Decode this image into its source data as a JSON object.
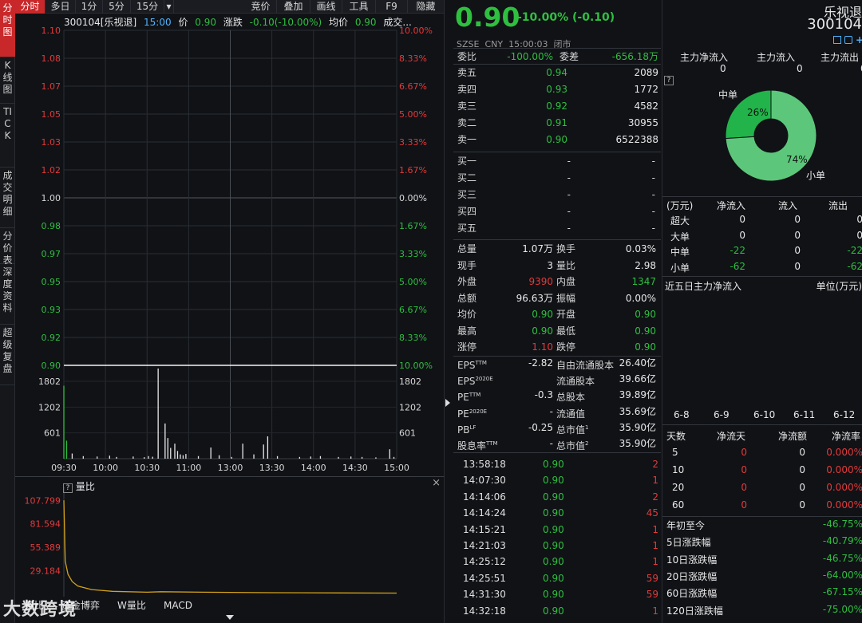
{
  "left_tabs": [
    "分时图",
    "K线图",
    "TICK",
    "成交明细",
    "分价表",
    "深度资料",
    "超级复盘"
  ],
  "toolbar": {
    "tabs": [
      "分时",
      "多日",
      "1分",
      "5分",
      "15分",
      "▾"
    ],
    "tools": [
      "竞价",
      "叠加",
      "画线",
      "工具",
      "F9",
      "隐藏"
    ]
  },
  "info": {
    "code_name": "300104[乐视退]",
    "time": "15:00",
    "price_label": "价",
    "price": "0.90",
    "change_label": "涨跌",
    "change": "-0.10(-10.00%)",
    "avg_label": "均价",
    "avg": "0.90",
    "vol_label": "成交..."
  },
  "chart_data": {
    "type": "line",
    "price_ticks": [
      "1.10",
      "1.08",
      "1.07",
      "1.05",
      "1.03",
      "1.02",
      "1.00",
      "0.98",
      "0.97",
      "0.95",
      "0.93",
      "0.92",
      "0.90"
    ],
    "pct_ticks": [
      "10.00%",
      "8.33%",
      "6.67%",
      "5.00%",
      "3.33%",
      "1.67%",
      "0.00%",
      "1.67%",
      "3.33%",
      "5.00%",
      "6.67%",
      "8.33%",
      "10.00%"
    ],
    "volume_ticks": [
      "1802",
      "1202",
      "601"
    ],
    "time_ticks": [
      "09:30",
      "10:00",
      "10:30",
      "11:00",
      "13:00",
      "13:30",
      "14:00",
      "14:30",
      "15:00"
    ],
    "price_line": {
      "value": 0.9,
      "from": "09:30",
      "to": "15:00"
    },
    "ylim": [
      0.9,
      1.1
    ],
    "volume_ylim": [
      0,
      2100
    ],
    "volume_bars": [
      {
        "t": 0,
        "v": 1700
      },
      {
        "t": 2,
        "v": 420
      },
      {
        "t": 6,
        "v": 120
      },
      {
        "t": 14,
        "v": 60
      },
      {
        "t": 24,
        "v": 50
      },
      {
        "t": 33,
        "v": 70
      },
      {
        "t": 38,
        "v": 40
      },
      {
        "t": 50,
        "v": 50
      },
      {
        "t": 58,
        "v": 35
      },
      {
        "t": 61,
        "v": 60
      },
      {
        "t": 64,
        "v": 45
      },
      {
        "t": 68,
        "v": 2100
      },
      {
        "t": 73,
        "v": 820
      },
      {
        "t": 75,
        "v": 480
      },
      {
        "t": 77,
        "v": 250
      },
      {
        "t": 80,
        "v": 350
      },
      {
        "t": 82,
        "v": 180
      },
      {
        "t": 84,
        "v": 100
      },
      {
        "t": 86,
        "v": 80
      },
      {
        "t": 88,
        "v": 110
      },
      {
        "t": 97,
        "v": 60
      },
      {
        "t": 106,
        "v": 260
      },
      {
        "t": 112,
        "v": 80
      },
      {
        "t": 121,
        "v": 40
      },
      {
        "t": 129,
        "v": 350
      },
      {
        "t": 137,
        "v": 100
      },
      {
        "t": 144,
        "v": 330
      },
      {
        "t": 147,
        "v": 520
      },
      {
        "t": 154,
        "v": 60
      },
      {
        "t": 170,
        "v": 40
      },
      {
        "t": 178,
        "v": 50
      },
      {
        "t": 185,
        "v": 60
      },
      {
        "t": 198,
        "v": 40
      },
      {
        "t": 207,
        "v": 50
      },
      {
        "t": 215,
        "v": 40
      },
      {
        "t": 225,
        "v": 30
      },
      {
        "t": 235,
        "v": 220
      },
      {
        "t": 238,
        "v": 40
      }
    ],
    "ratio_ticks": [
      "107.799",
      "81.594",
      "55.389",
      "29.184"
    ],
    "ratio_ylim": [
      0,
      118
    ],
    "ratio_series": [
      {
        "t": 0,
        "v": 108
      },
      {
        "t": 1,
        "v": 40
      },
      {
        "t": 3,
        "v": 25
      },
      {
        "t": 6,
        "v": 17
      },
      {
        "t": 10,
        "v": 12
      },
      {
        "t": 20,
        "v": 8
      },
      {
        "t": 35,
        "v": 6
      },
      {
        "t": 60,
        "v": 5
      },
      {
        "t": 70,
        "v": 5.5
      },
      {
        "t": 100,
        "v": 5
      },
      {
        "t": 150,
        "v": 4.5
      },
      {
        "t": 200,
        "v": 4.2
      },
      {
        "t": 240,
        "v": 4
      }
    ]
  },
  "lower_panel": {
    "title": "量比",
    "tabs": [
      "量比",
      "资金博弈",
      "W量比",
      "MACD"
    ]
  },
  "quote": {
    "price": "0.90",
    "change": "-10.00% (-0.10)",
    "exchange": "SZSE",
    "currency": "CNY",
    "time": "15:00:03",
    "status": "闭市",
    "weibi_label": "委比",
    "weibi": "-100.00%",
    "weicha_label": "委差",
    "weicha": "-656.18万",
    "asks": [
      {
        "label": "卖五",
        "price": "0.94",
        "vol": "2089"
      },
      {
        "label": "卖四",
        "price": "0.93",
        "vol": "1772"
      },
      {
        "label": "卖三",
        "price": "0.92",
        "vol": "4582"
      },
      {
        "label": "卖二",
        "price": "0.91",
        "vol": "30955"
      },
      {
        "label": "卖一",
        "price": "0.90",
        "vol": "6522388"
      }
    ],
    "bids": [
      {
        "label": "买一",
        "price": "-",
        "vol": "-"
      },
      {
        "label": "买二",
        "price": "-",
        "vol": "-"
      },
      {
        "label": "买三",
        "price": "-",
        "vol": "-"
      },
      {
        "label": "买四",
        "price": "-",
        "vol": "-"
      },
      {
        "label": "买五",
        "price": "-",
        "vol": "-"
      }
    ],
    "stats": [
      {
        "l1": "总量",
        "v1": "1.07万",
        "l2": "换手",
        "v2": "0.03%",
        "c1": "white",
        "c2": "white"
      },
      {
        "l1": "现手",
        "v1": "3",
        "l2": "量比",
        "v2": "2.98",
        "c1": "white",
        "c2": "white"
      },
      {
        "l1": "外盘",
        "v1": "9390",
        "l2": "内盘",
        "v2": "1347",
        "c1": "red",
        "c2": "green"
      },
      {
        "l1": "总额",
        "v1": "96.63万",
        "l2": "振幅",
        "v2": "0.00%",
        "c1": "white",
        "c2": "white"
      },
      {
        "l1": "均价",
        "v1": "0.90",
        "l2": "开盘",
        "v2": "0.90",
        "c1": "green",
        "c2": "green"
      },
      {
        "l1": "最高",
        "v1": "0.90",
        "l2": "最低",
        "v2": "0.90",
        "c1": "green",
        "c2": "green"
      },
      {
        "l1": "涨停",
        "v1": "1.10",
        "l2": "跌停",
        "v2": "0.90",
        "c1": "red",
        "c2": "green"
      }
    ],
    "fundamentals": [
      {
        "l1": "EPS",
        "s1": "TTM",
        "v1": "-2.82",
        "l2": "自由流通股本",
        "s2": "",
        "v2": "26.40亿"
      },
      {
        "l1": "EPS",
        "s1": "2020E",
        "v1": "",
        "l2": "流通股本",
        "s2": "",
        "v2": "39.66亿"
      },
      {
        "l1": "PE",
        "s1": "TTM",
        "v1": "-0.3",
        "l2": "总股本",
        "s2": "",
        "v2": "39.89亿"
      },
      {
        "l1": "PE",
        "s1": "2020E",
        "v1": "-",
        "l2": "流通值",
        "s2": "",
        "v2": "35.69亿"
      },
      {
        "l1": "PB",
        "s1": "LF",
        "v1": "-0.25",
        "l2": "总市值",
        "s2": "1",
        "v2": "35.90亿"
      },
      {
        "l1": "股息率",
        "s1": "TTM",
        "v1": "-",
        "l2": "总市值",
        "s2": "2",
        "v2": "35.90亿"
      }
    ],
    "ticks": [
      {
        "t": "13:58:18",
        "p": "0.90",
        "v": "2"
      },
      {
        "t": "14:07:30",
        "p": "0.90",
        "v": "1"
      },
      {
        "t": "14:14:06",
        "p": "0.90",
        "v": "2"
      },
      {
        "t": "14:14:24",
        "p": "0.90",
        "v": "45"
      },
      {
        "t": "14:15:21",
        "p": "0.90",
        "v": "1"
      },
      {
        "t": "14:21:03",
        "p": "0.90",
        "v": "1"
      },
      {
        "t": "14:25:12",
        "p": "0.90",
        "v": "1"
      },
      {
        "t": "14:25:51",
        "p": "0.90",
        "v": "59"
      },
      {
        "t": "14:31:30",
        "p": "0.90",
        "v": "59"
      },
      {
        "t": "14:32:18",
        "p": "0.90",
        "v": "1"
      }
    ]
  },
  "flow": {
    "name": "乐视退",
    "code": "300104",
    "headers": [
      "主力净流入",
      "主力流入",
      "主力流出"
    ],
    "values": [
      "0",
      "0",
      "0"
    ],
    "help": "?",
    "donut": {
      "mid_label": "中单",
      "mid_pct": "26%",
      "small_label": "小单",
      "small_pct": "74%",
      "mid_value": 26,
      "small_value": 74
    },
    "table_headers": [
      "(万元)",
      "净流入",
      "流入",
      "流出"
    ],
    "table_rows": [
      {
        "name": "超大",
        "net": "0",
        "in": "0",
        "out": "0",
        "c": "white"
      },
      {
        "name": "大单",
        "net": "0",
        "in": "0",
        "out": "0",
        "c": "white"
      },
      {
        "name": "中单",
        "net": "-22",
        "in": "0",
        "out": "-22",
        "c": "green"
      },
      {
        "name": "小单",
        "net": "-62",
        "in": "0",
        "out": "-62",
        "c": "green"
      }
    ],
    "five_day_title": "近五日主力净流入",
    "five_day_unit": "单位(万元)",
    "five_day_dates": [
      "6-8",
      "6-9",
      "6-10",
      "6-11",
      "6-12"
    ],
    "days_headers": [
      "天数",
      "净流天",
      "净流额",
      "净流率"
    ],
    "days_rows": [
      {
        "d": "5",
        "a": "0",
        "b": "0",
        "c": "0.000%"
      },
      {
        "d": "10",
        "a": "0",
        "b": "0",
        "c": "0.000%"
      },
      {
        "d": "20",
        "a": "0",
        "b": "0",
        "c": "0.000%"
      },
      {
        "d": "60",
        "a": "0",
        "b": "0",
        "c": "0.000%"
      }
    ],
    "perf": [
      {
        "l": "年初至今",
        "v": "-46.75%"
      },
      {
        "l": "5日涨跌幅",
        "v": "-40.79%"
      },
      {
        "l": "10日涨跌幅",
        "v": "-46.75%"
      },
      {
        "l": "20日涨跌幅",
        "v": "-64.00%"
      },
      {
        "l": "60日涨跌幅",
        "v": "-67.15%"
      },
      {
        "l": "120日涨跌幅",
        "v": "-75.00%"
      }
    ]
  },
  "watermark": "大数跨境",
  "colors": {
    "up": "#e33a3a",
    "down": "#2fbf3f",
    "active_tab": "#c8282a",
    "ratio_line": "#d4a21a",
    "donut_small": "#5cc77a",
    "donut_mid": "#22b34a"
  }
}
